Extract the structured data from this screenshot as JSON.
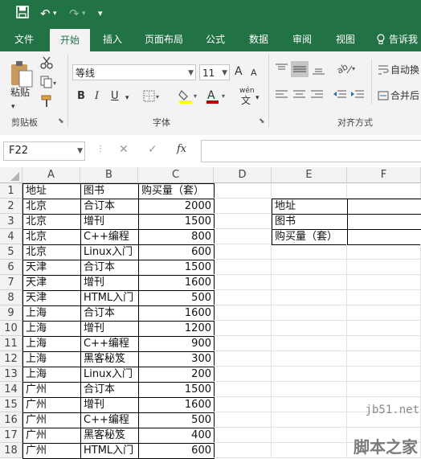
{
  "quick_access": {
    "save_icon": "floppy-icon",
    "undo": "↶",
    "redo": "↷",
    "more": "▾"
  },
  "tabs": [
    {
      "label": "文件",
      "active": false
    },
    {
      "label": "开始",
      "active": true
    },
    {
      "label": "插入",
      "active": false
    },
    {
      "label": "页面布局",
      "active": false
    },
    {
      "label": "公式",
      "active": false
    },
    {
      "label": "数据",
      "active": false
    },
    {
      "label": "审阅",
      "active": false
    },
    {
      "label": "视图",
      "active": false
    },
    {
      "label": "告诉我",
      "active": false
    }
  ],
  "ribbon": {
    "clipboard": {
      "paste_label": "粘贴",
      "group_label": "剪贴板"
    },
    "font": {
      "font_name": "等线",
      "font_size": "11",
      "bold": "B",
      "italic": "I",
      "underline": "U",
      "grow": "A",
      "shrink": "A",
      "wen": "wén",
      "group_label": "字体",
      "font_color": "#c00000",
      "fill_color": "#ffff00"
    },
    "alignment": {
      "group_label": "对齐方式",
      "wrap_label": "自动换",
      "merge_label": "合并后"
    }
  },
  "formula_bar": {
    "name_box": "F22",
    "cancel": "✕",
    "confirm": "✓",
    "fx": "fx",
    "value": ""
  },
  "columns": [
    "A",
    "B",
    "C",
    "D",
    "E",
    "F"
  ],
  "rows": [
    {
      "n": "1",
      "a": "地址",
      "b": "图书",
      "c": "购买量（套）"
    },
    {
      "n": "2",
      "a": "北京",
      "b": "合订本",
      "c": "2000"
    },
    {
      "n": "3",
      "a": "北京",
      "b": "增刊",
      "c": "1500"
    },
    {
      "n": "4",
      "a": "北京",
      "b": "C++编程",
      "c": "800"
    },
    {
      "n": "5",
      "a": "北京",
      "b": "Linux入门",
      "c": "600"
    },
    {
      "n": "6",
      "a": "天津",
      "b": "合订本",
      "c": "1500"
    },
    {
      "n": "7",
      "a": "天津",
      "b": "增刊",
      "c": "1600"
    },
    {
      "n": "8",
      "a": "天津",
      "b": "HTML入门",
      "c": "500"
    },
    {
      "n": "9",
      "a": "上海",
      "b": "合订本",
      "c": "1600"
    },
    {
      "n": "10",
      "a": "上海",
      "b": "增刊",
      "c": "1200"
    },
    {
      "n": "11",
      "a": "上海",
      "b": "C++编程",
      "c": "900"
    },
    {
      "n": "12",
      "a": "上海",
      "b": "黑客秘笈",
      "c": "300"
    },
    {
      "n": "13",
      "a": "上海",
      "b": "Linux入门",
      "c": "200"
    },
    {
      "n": "14",
      "a": "广州",
      "b": "合订本",
      "c": "1500"
    },
    {
      "n": "15",
      "a": "广州",
      "b": "增刊",
      "c": "1600"
    },
    {
      "n": "16",
      "a": "广州",
      "b": "C++编程",
      "c": "500"
    },
    {
      "n": "17",
      "a": "广州",
      "b": "黑客秘笈",
      "c": "400"
    },
    {
      "n": "18",
      "a": "广州",
      "b": "HTML入门",
      "c": "600"
    }
  ],
  "criteria": [
    {
      "e": "地址",
      "f": ""
    },
    {
      "e": "图书",
      "f": ""
    },
    {
      "e": "购买量（套）",
      "f": ""
    }
  ],
  "watermark": {
    "site": "jb51.net",
    "brand": "脚本之家"
  }
}
